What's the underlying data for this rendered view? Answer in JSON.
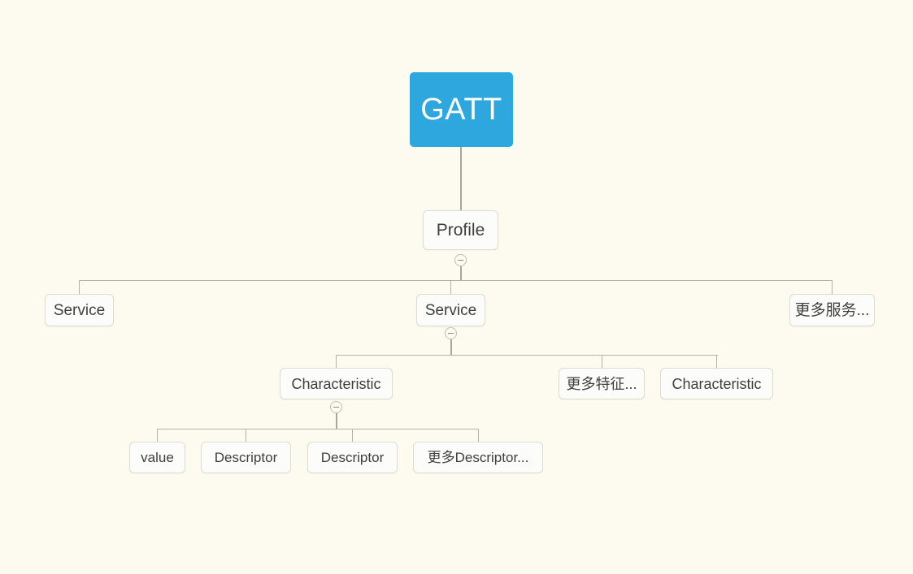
{
  "diagram": {
    "title": "GATT",
    "background_color": "#fdfaef",
    "accent_color": "#2ea7de",
    "node_border_color": "#dedbd0",
    "connector_color": "#a9a69a",
    "toggle_icon": "minus-circle-icon"
  },
  "nodes": {
    "root": {
      "label": "GATT"
    },
    "profile": {
      "label": "Profile"
    },
    "service_left": {
      "label": "Service"
    },
    "service_mid": {
      "label": "Service"
    },
    "service_more": {
      "label": "更多服务..."
    },
    "characteristic_left": {
      "label": "Characteristic"
    },
    "characteristic_more": {
      "label": "更多特征..."
    },
    "characteristic_right": {
      "label": "Characteristic"
    },
    "value": {
      "label": "value"
    },
    "descriptor_1": {
      "label": "Descriptor"
    },
    "descriptor_2": {
      "label": "Descriptor"
    },
    "descriptor_more": {
      "label": "更多Descriptor..."
    }
  }
}
